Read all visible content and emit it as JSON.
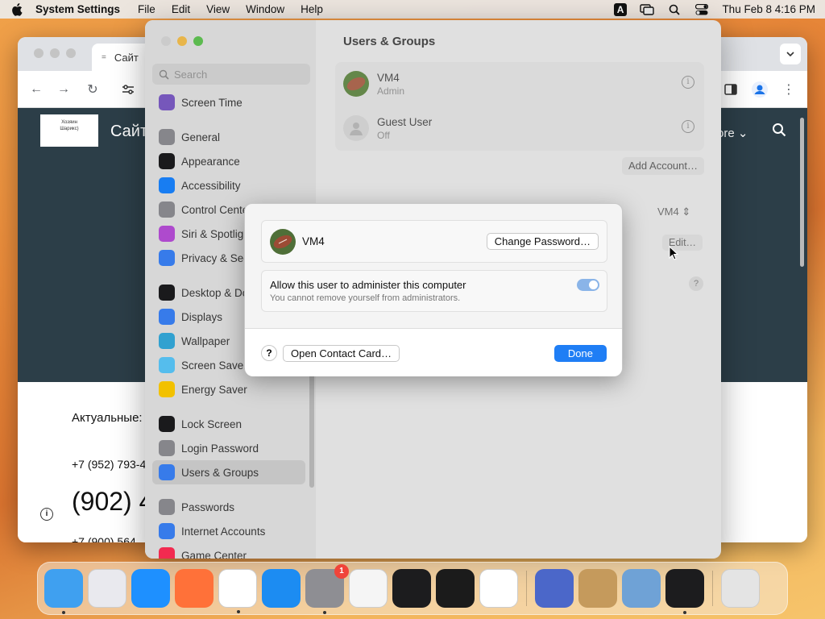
{
  "menubar": {
    "app_name": "System Settings",
    "items": [
      "File",
      "Edit",
      "View",
      "Window",
      "Help"
    ],
    "keyboard_badge": "A",
    "datetime": "Thu Feb 8  4:16 PM"
  },
  "browser": {
    "tab_title": "Сайт",
    "logo_text_1": "Хозяин",
    "logo_text_2": "Шарикс)",
    "site_title": "Сайт",
    "more_link": "ore",
    "actual_label": "Актуальные:",
    "phone_small": "+7 (952) 793-4",
    "phone_big": "(902) 4",
    "phone_small_2": "+7 (900) 564"
  },
  "settings": {
    "search_placeholder": "Search",
    "sidebar": [
      {
        "label": "Screen Time",
        "color": "#7d5cc6"
      },
      {
        "label": "General",
        "color": "#8e8e93"
      },
      {
        "label": "Appearance",
        "color": "#1c1c1e"
      },
      {
        "label": "Accessibility",
        "color": "#1a84ff"
      },
      {
        "label": "Control Center",
        "color": "#8e8e93"
      },
      {
        "label": "Siri & Spotlight",
        "color": "#b84fd8"
      },
      {
        "label": "Privacy & Security",
        "color": "#3a82f7"
      },
      {
        "label": "Desktop & Dock",
        "color": "#1c1c1e"
      },
      {
        "label": "Displays",
        "color": "#3a82f7"
      },
      {
        "label": "Wallpaper",
        "color": "#34aadc"
      },
      {
        "label": "Screen Saver",
        "color": "#5ac8fa"
      },
      {
        "label": "Energy Saver",
        "color": "#ffcc00"
      },
      {
        "label": "Lock Screen",
        "color": "#1c1c1e"
      },
      {
        "label": "Login Password",
        "color": "#8e8e93"
      },
      {
        "label": "Users & Groups",
        "color": "#3a82f7"
      },
      {
        "label": "Passwords",
        "color": "#8e8e93"
      },
      {
        "label": "Internet Accounts",
        "color": "#3a82f7"
      },
      {
        "label": "Game Center",
        "color": "#ff2d55"
      }
    ],
    "pane_title": "Users & Groups",
    "users": [
      {
        "name": "VM4",
        "role": "Admin"
      },
      {
        "name": "Guest User",
        "role": "Off"
      }
    ],
    "add_account": "Add Account…",
    "vm4_select": "VM4",
    "edit_button": "Edit…"
  },
  "sheet": {
    "user_name": "VM4",
    "change_password": "Change Password…",
    "allow_title": "Allow this user to administer this computer",
    "allow_sub": "You cannot remove yourself from administrators.",
    "help": "?",
    "open_contact": "Open Contact Card…",
    "done": "Done",
    "toggle_on": true
  },
  "dock": {
    "apps": [
      {
        "name": "Finder",
        "color": "#3fa0f0",
        "running": true
      },
      {
        "name": "Launchpad",
        "color": "#e9e9ee",
        "running": false
      },
      {
        "name": "Safari",
        "color": "#1e90ff",
        "running": false
      },
      {
        "name": "Firefox",
        "color": "#ff7139",
        "running": false
      },
      {
        "name": "Chrome",
        "color": "#ffffff",
        "running": true
      },
      {
        "name": "App Store",
        "color": "#1c8cf2",
        "running": false
      },
      {
        "name": "System Settings",
        "color": "#8e8e93",
        "running": true,
        "badge": "1"
      },
      {
        "name": "TextEdit",
        "color": "#f5f5f5",
        "running": false
      },
      {
        "name": "Terminal",
        "color": "#1c1c1e",
        "running": false
      },
      {
        "name": "GarageBand",
        "color": "#1b1b1b",
        "running": false
      },
      {
        "name": "VS Code",
        "color": "#ffffff",
        "running": false
      },
      {
        "name": "Remote App",
        "color": "#4b67c9",
        "running": false
      },
      {
        "name": "Contacts",
        "color": "#c59a5c",
        "running": false
      },
      {
        "name": "Finder Helper",
        "color": "#6fa2d6",
        "running": false
      },
      {
        "name": "Bartender",
        "color": "#1c1c1e",
        "running": true
      },
      {
        "name": "Trash",
        "color": "#e4e4e4",
        "running": false
      }
    ]
  }
}
